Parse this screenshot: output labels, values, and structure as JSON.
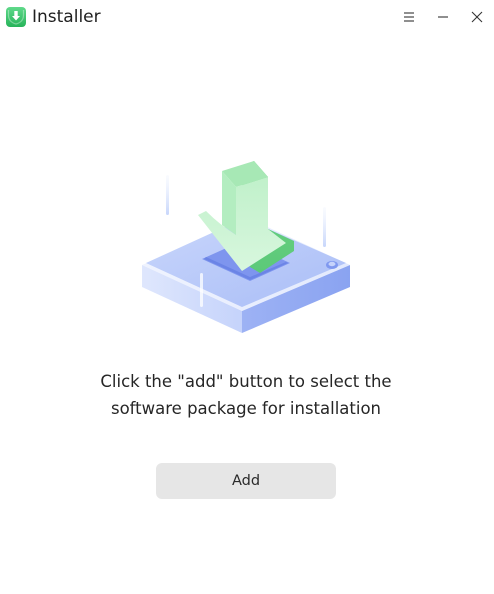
{
  "window": {
    "title": "Installer",
    "icon": "installer-download-icon"
  },
  "titlebar_buttons": {
    "menu_icon": "hamburger-menu-icon",
    "minimize_icon": "minimize-icon",
    "close_icon": "close-icon"
  },
  "main": {
    "message_line1": "Click the \"add\" button to select the",
    "message_line2": "software package for installation",
    "add_label": "Add",
    "illustration_icon": "package-install-illustration"
  },
  "colors": {
    "accent_green": "#3ec46d",
    "tray_blue": "#9fb4f6",
    "button_bg": "#e6e6e6"
  }
}
